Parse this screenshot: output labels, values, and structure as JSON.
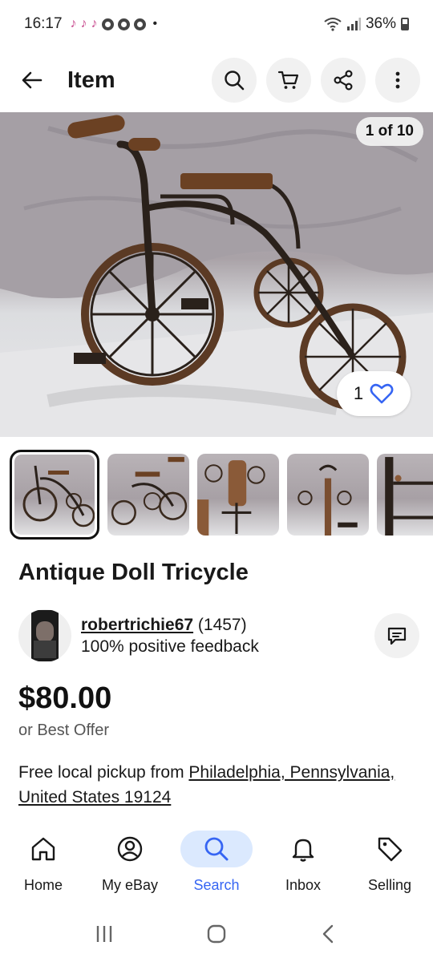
{
  "status_bar": {
    "time": "16:17",
    "battery": "36%"
  },
  "header": {
    "title": "Item",
    "actions": [
      "search-icon",
      "cart-icon",
      "share-icon",
      "more-vertical-icon"
    ]
  },
  "gallery": {
    "counter": "1 of 10",
    "like_count": "1",
    "thumbnail_count": 5,
    "selected_index": 0
  },
  "item": {
    "title": "Antique Doll Tricycle",
    "price": "$80.00",
    "best_offer": "or Best Offer",
    "pickup_prefix": "Free local pickup from ",
    "pickup_location": "Philadelphia, Pennsylvania, United States 19124"
  },
  "seller": {
    "name": "robertrichie67",
    "score": "(1457)",
    "feedback": "100% positive feedback"
  },
  "bottom_nav": {
    "items": [
      {
        "label": "Home",
        "icon": "home-icon"
      },
      {
        "label": "My eBay",
        "icon": "user-icon"
      },
      {
        "label": "Search",
        "icon": "search-icon",
        "active": true
      },
      {
        "label": "Inbox",
        "icon": "bell-icon"
      },
      {
        "label": "Selling",
        "icon": "tag-icon"
      }
    ]
  },
  "colors": {
    "accent": "#3665f3",
    "active_nav_bg": "#dbe9fe",
    "text": "#191919",
    "muted": "#555555",
    "button_bg": "#f1f1f1"
  }
}
